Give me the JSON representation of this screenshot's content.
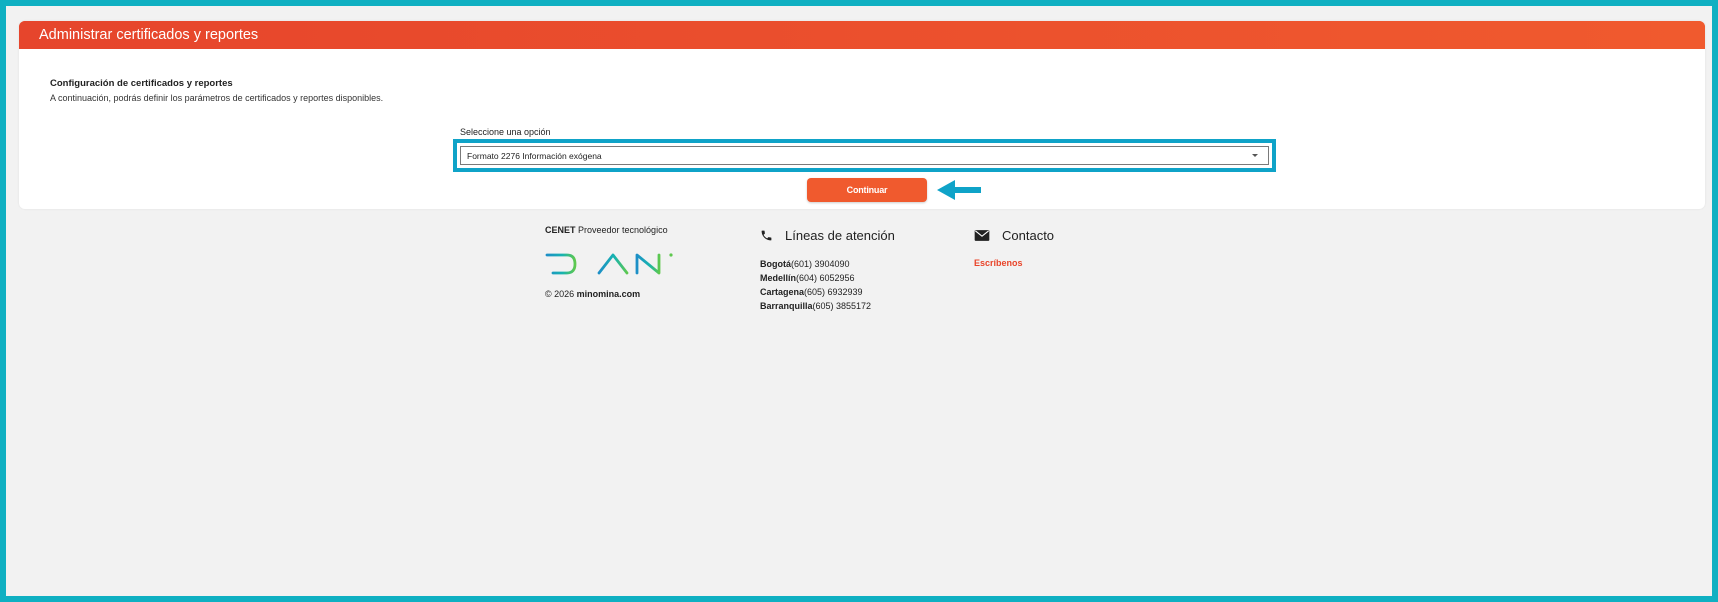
{
  "header": {
    "title": "Administrar certificados y reportes"
  },
  "config": {
    "title": "Configuración de certificados y reportes",
    "description": "A continuación, podrás definir los parámetros de certificados y reportes disponibles."
  },
  "select": {
    "label": "Seleccione una opción",
    "value": "Formato 2276 Información exógena"
  },
  "actions": {
    "continue_label": "Continuar"
  },
  "footer": {
    "provider": {
      "brand": "CENET",
      "text": " Proveedor tecnológico"
    },
    "logo_text": "DIAN",
    "copyright": {
      "prefix": "© 2026 ",
      "site": "minomina.com"
    },
    "support": {
      "title": "Líneas de atención",
      "lines": [
        {
          "city": "Bogotá",
          "phone": "(601) 3904090"
        },
        {
          "city": "Medellín",
          "phone": "(604) 6052956"
        },
        {
          "city": "Cartagena",
          "phone": "(605) 6932939"
        },
        {
          "city": "Barranquilla",
          "phone": "(605) 3855172"
        }
      ]
    },
    "contact": {
      "title": "Contacto",
      "link_label": "Escríbenos"
    }
  },
  "icons": {
    "phone": "phone-icon",
    "mail": "envelope-icon",
    "caret": "chevron-down-icon",
    "arrow": "arrow-left-icon"
  },
  "colors": {
    "accent": "#f05a2e",
    "highlight": "#0fa3c8",
    "frame": "#0fb0c2",
    "link": "#e9452a",
    "background": "#f2f2f2"
  }
}
